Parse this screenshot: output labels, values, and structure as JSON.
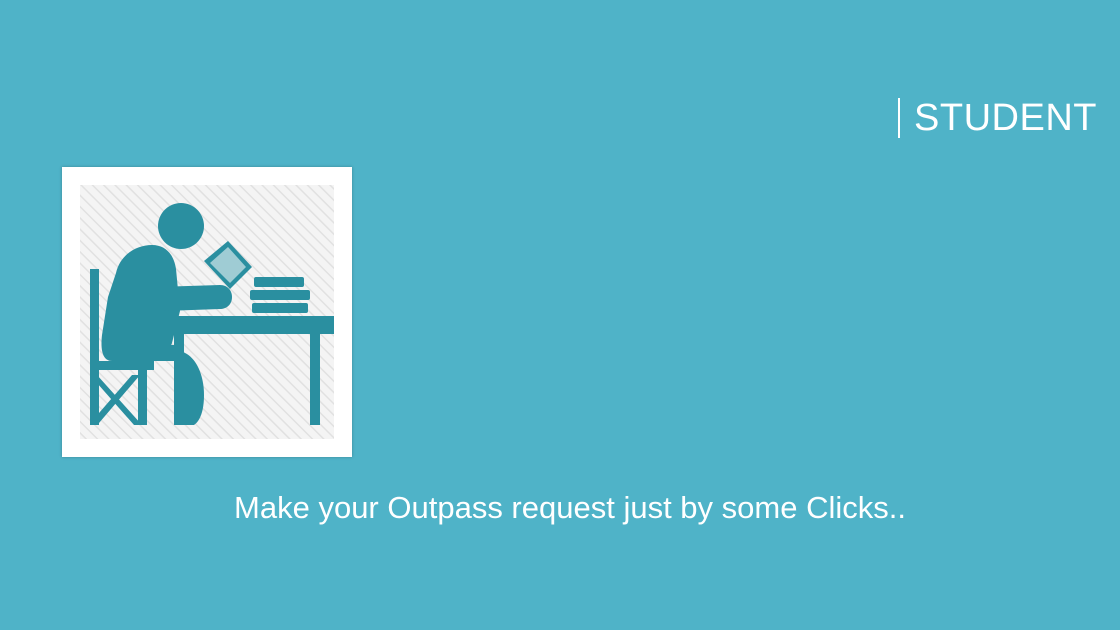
{
  "slide": {
    "heading": "STUDENT",
    "tagline": "Make your Outpass request just by some Clicks..",
    "illustration_icon": "student-studying-at-desk-icon"
  },
  "colors": {
    "background": "#4fb3c8",
    "icon": "#2a8fa0",
    "text": "#ffffff"
  }
}
